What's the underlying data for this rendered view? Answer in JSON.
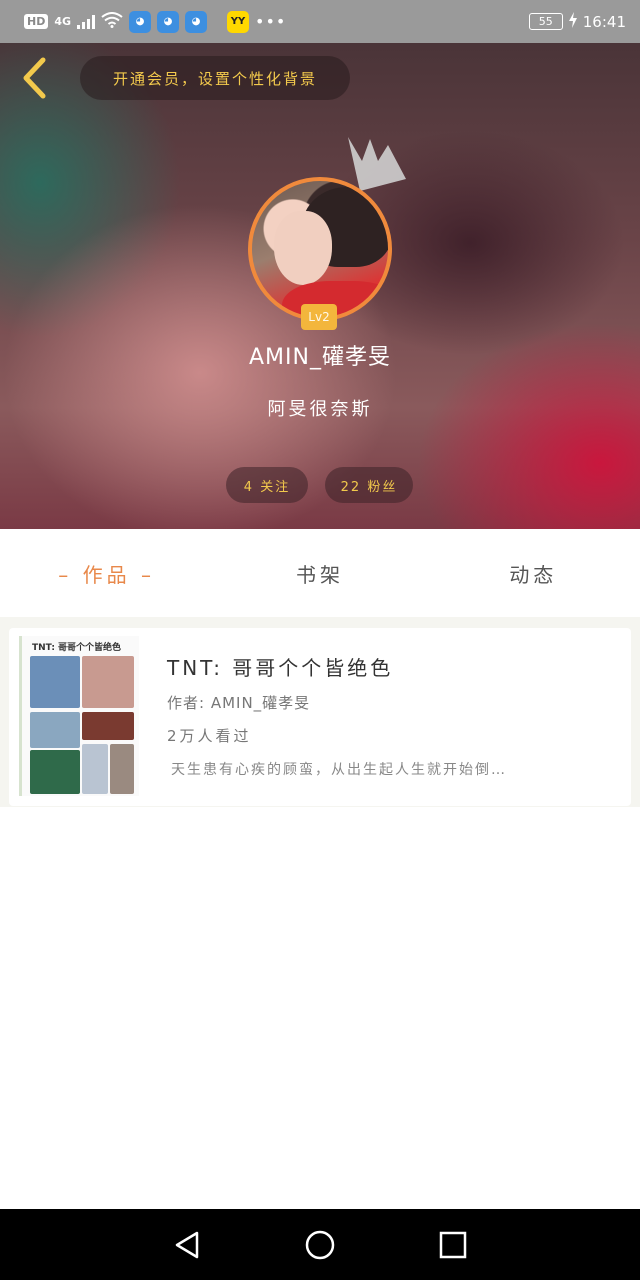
{
  "status_bar": {
    "hd": "HD",
    "network": "4G",
    "yy_label": "YY",
    "more": "•••",
    "battery": "55",
    "time": "16:41"
  },
  "header": {
    "vip_prompt": "开通会员，设置个性化背景",
    "level": "Lv2",
    "username": "AMIN_礶孝旻",
    "signature": "阿旻很奈斯",
    "following": "4 关注",
    "fans": "22 粉丝"
  },
  "tabs": [
    {
      "label": "– 作品 –",
      "active": true
    },
    {
      "label": "书架",
      "active": false
    },
    {
      "label": "动态",
      "active": false
    }
  ],
  "works": [
    {
      "cover_text": "TNT: 哥哥个个皆绝色",
      "title": "TNT:  哥哥个个皆绝色",
      "author": "作者: AMIN_礶孝旻",
      "views": "2万人看过",
      "description": "天生患有心疾的顾蛮，从出生起人生就开始倒…"
    }
  ],
  "colors": {
    "accent": "#e8884a",
    "gold": "#f2c94c",
    "avatar_ring": "#f08a3c"
  }
}
